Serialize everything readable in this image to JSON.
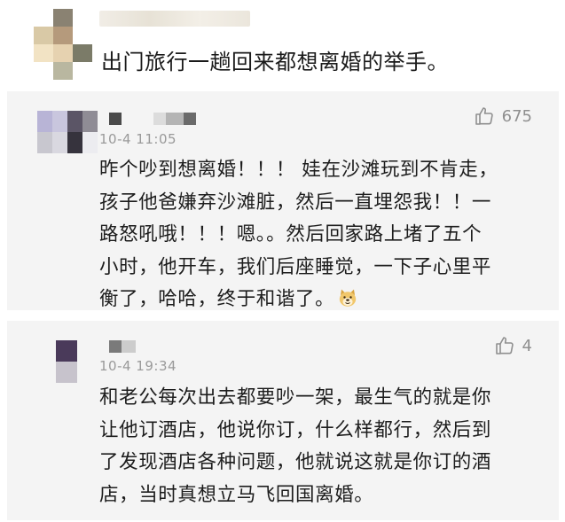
{
  "post": {
    "text": "出门旅行一趟回来都想离婚的举手。",
    "avatar_colors": [
      "#ffffff",
      "#8a8272",
      "#ffffff",
      "#d9c9a6",
      "#b59a7c",
      "#ffffff",
      "#f2e3c4",
      "#e6d2b0",
      "#7b7b68",
      "#ffffff",
      "#b9b7a0",
      "#ffffff"
    ]
  },
  "comments": [
    {
      "timestamp": "10-4 11:05",
      "likes": "675",
      "lines": [
        "昨个吵到想离婚！！！ 娃在沙滩玩到不肯走，",
        "孩子他爸嫌弃沙滩脏，然后一直埋怨我！！一",
        "路怒吼哦！！！嗯。。然后回家路上堵了五个",
        "小时，他开车，我们后座睡觉，一下子心里平",
        "衡了，哈哈，终于和谐了。"
      ],
      "emoji": "doge-emoji",
      "avatar_colors": [
        "#b8b4d6",
        "#c9c6de",
        "#5b5566",
        "#8f8c95",
        "#c8c7cf",
        "#d9d8e0",
        "#36333d",
        "#ececf0"
      ],
      "name_blur_colors": [
        "#4a4a4a",
        "#dcdcdc",
        "#b4b4b4",
        "#6a6a6a"
      ]
    },
    {
      "timestamp": "10-4 19:34",
      "likes": "4",
      "lines": [
        "和老公每次出去都要吵一架，最生气的就是你",
        "让他订酒店，他说你订，什么样都行，然后到",
        "了发现酒店各种问题，他就说这就是你订的酒",
        "店，当时真想立马飞回国离婚。"
      ],
      "avatar_colors": [
        "#4a3a5a",
        "#c7c3cc"
      ],
      "name_blur_colors": [
        "#7a7a7a",
        "#cccccc"
      ]
    }
  ]
}
